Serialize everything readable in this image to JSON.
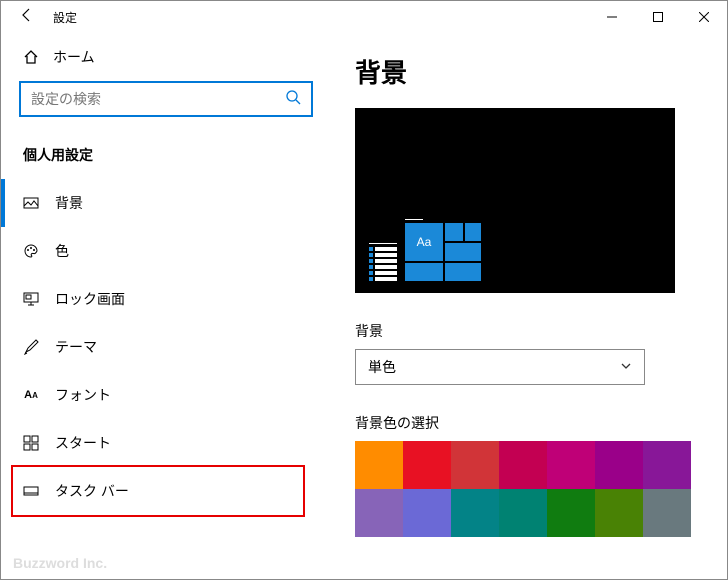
{
  "window": {
    "title": "設定"
  },
  "sidebar": {
    "home": "ホーム",
    "search_placeholder": "設定の検索",
    "section": "個人用設定",
    "items": [
      {
        "label": "背景",
        "icon": "image",
        "selected": true,
        "highlight": false
      },
      {
        "label": "色",
        "icon": "palette",
        "selected": false,
        "highlight": false
      },
      {
        "label": "ロック画面",
        "icon": "monitor",
        "selected": false,
        "highlight": false
      },
      {
        "label": "テーマ",
        "icon": "brush",
        "selected": false,
        "highlight": false
      },
      {
        "label": "フォント",
        "icon": "font",
        "selected": false,
        "highlight": false
      },
      {
        "label": "スタート",
        "icon": "grid",
        "selected": false,
        "highlight": false
      },
      {
        "label": "タスク バー",
        "icon": "taskbar",
        "selected": false,
        "highlight": true
      }
    ]
  },
  "content": {
    "heading": "背景",
    "preview_sample_text": "Aa",
    "background_label": "背景",
    "background_value": "単色",
    "color_section": "背景色の選択",
    "colors": [
      "#ff8c00",
      "#e81123",
      "#d13438",
      "#c30052",
      "#bf0077",
      "#9a0089",
      "#881798",
      "#8764b8",
      "#6b69d6",
      "#038387",
      "#008272",
      "#107c10",
      "#498205",
      "#69797e"
    ]
  },
  "watermark": "Buzzword Inc."
}
